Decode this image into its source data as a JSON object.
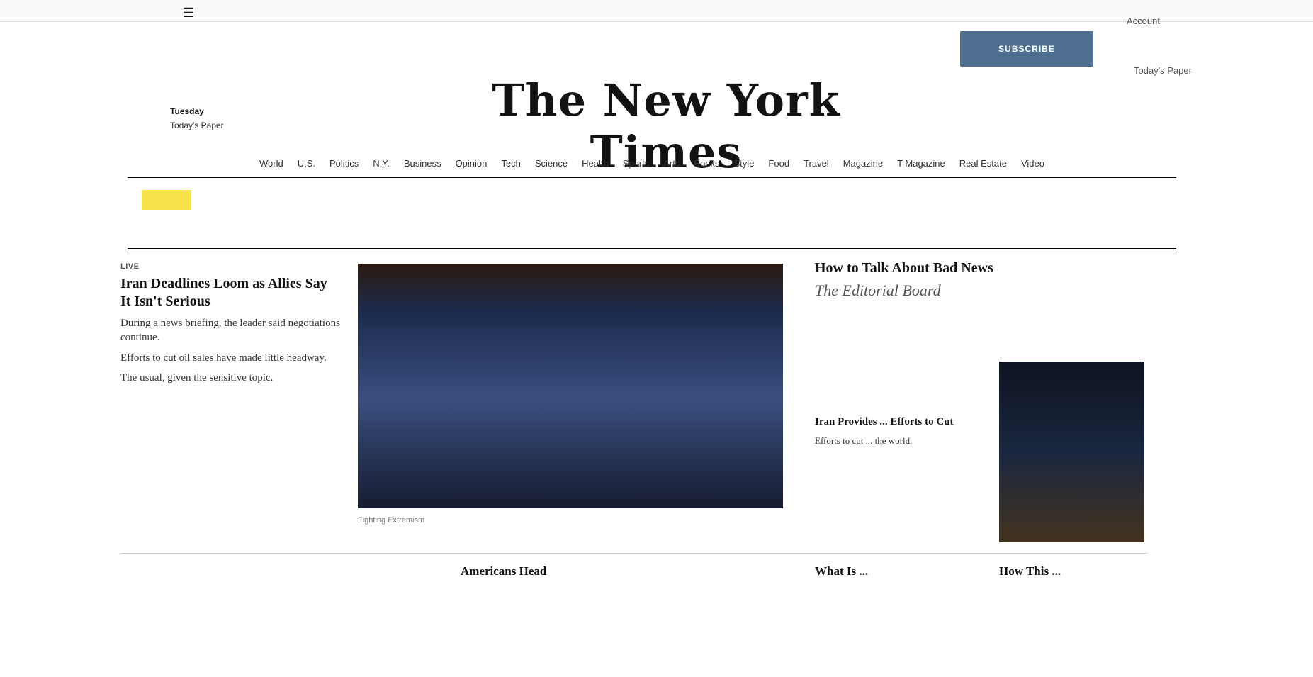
{
  "topbar": {
    "account": "Account"
  },
  "subscribe": {
    "label": "SUBSCRIBE"
  },
  "header": {
    "today_paper": "Today's Paper",
    "date": "Tuesday",
    "subdate": "Today's Paper",
    "masthead": "The New York Times"
  },
  "nav": {
    "items": [
      "World",
      "U.S.",
      "Politics",
      "N.Y.",
      "Business",
      "Opinion",
      "Tech",
      "Science",
      "Health",
      "Sports",
      "Arts",
      "Books",
      "Style",
      "Food",
      "Travel",
      "Magazine",
      "T Magazine",
      "Real Estate",
      "Video"
    ]
  },
  "left": {
    "label": "Live",
    "headline": "Iran Deadlines Loom as Allies Say It Isn't Serious",
    "summary1": "During a news briefing, the leader said negotiations continue.",
    "summary2": "Efforts to cut oil sales have made little headway.",
    "summary3": "The usual, given the sensitive topic."
  },
  "main": {
    "caption": "Fighting Extremism",
    "photo_credit": ""
  },
  "right": {
    "headline1": "How to Talk About Bad News",
    "opinion": "The Editorial Board",
    "story_headline": "Iran Provides ... Efforts to Cut",
    "story_summary": "Efforts to cut ... the world."
  },
  "bottom": {
    "col1_headline": "Americans Head",
    "col2_headline": "What Is ...",
    "col3_headline": "How This ..."
  },
  "colors": {
    "subscribe_bg": "#4e6f90",
    "ticker_badge": "#f7e24c"
  }
}
